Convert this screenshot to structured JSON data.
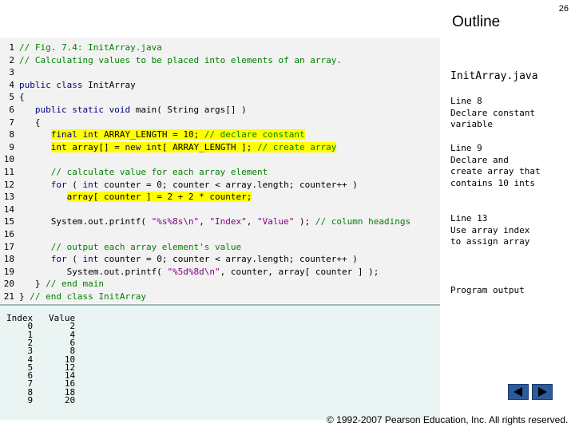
{
  "header": {
    "title": "Outline",
    "page_number": "26"
  },
  "code": {
    "lines": [
      {
        "n": "1",
        "parts": [
          {
            "t": "// Fig. 7.4: InitArray.java",
            "c": "cm"
          }
        ]
      },
      {
        "n": "2",
        "parts": [
          {
            "t": "// Calculating values to be placed into elements of an array.",
            "c": "cm"
          }
        ]
      },
      {
        "n": "3",
        "parts": []
      },
      {
        "n": "4",
        "parts": [
          {
            "t": "public class",
            "c": "kw"
          },
          {
            "t": " InitArray",
            "c": ""
          }
        ]
      },
      {
        "n": "5",
        "parts": [
          {
            "t": "{",
            "c": ""
          }
        ]
      },
      {
        "n": "6",
        "parts": [
          {
            "t": "   public static void",
            "c": "kw"
          },
          {
            "t": " main( String args[] )",
            "c": ""
          }
        ]
      },
      {
        "n": "7",
        "parts": [
          {
            "t": "   {",
            "c": ""
          }
        ]
      },
      {
        "n": "8",
        "parts": [
          {
            "t": "      ",
            "c": ""
          },
          {
            "t": "final int",
            "c": "kw",
            "h": true
          },
          {
            "t": " ARRAY_LENGTH = 10; ",
            "c": "",
            "h": true
          },
          {
            "t": "// declare constant",
            "c": "cm",
            "h": true
          }
        ]
      },
      {
        "n": "9",
        "parts": [
          {
            "t": "      ",
            "c": ""
          },
          {
            "t": "int",
            "c": "kw",
            "h": true
          },
          {
            "t": " array[] = ",
            "c": "",
            "h": true
          },
          {
            "t": "new int",
            "c": "kw",
            "h": true
          },
          {
            "t": "[ ARRAY_LENGTH ]; ",
            "c": "",
            "h": true
          },
          {
            "t": "// create array",
            "c": "cm",
            "h": true
          }
        ]
      },
      {
        "n": "10",
        "parts": []
      },
      {
        "n": "11",
        "parts": [
          {
            "t": "      // calculate value for each array element",
            "c": "cm"
          }
        ]
      },
      {
        "n": "12",
        "parts": [
          {
            "t": "      ",
            "c": ""
          },
          {
            "t": "for",
            "c": "kw"
          },
          {
            "t": " ( ",
            "c": ""
          },
          {
            "t": "int",
            "c": "kw"
          },
          {
            "t": " counter = 0; counter < array.length; counter++ )",
            "c": ""
          }
        ]
      },
      {
        "n": "13",
        "parts": [
          {
            "t": "         ",
            "c": ""
          },
          {
            "t": "array[ counter ] = 2 + 2 * counter;",
            "c": "",
            "h": true
          }
        ]
      },
      {
        "n": "14",
        "parts": []
      },
      {
        "n": "15",
        "parts": [
          {
            "t": "      System.out.printf( ",
            "c": ""
          },
          {
            "t": "\"%s%8s\\n\"",
            "c": "st"
          },
          {
            "t": ", ",
            "c": ""
          },
          {
            "t": "\"Index\"",
            "c": "st"
          },
          {
            "t": ", ",
            "c": ""
          },
          {
            "t": "\"Value\"",
            "c": "st"
          },
          {
            "t": " ); ",
            "c": ""
          },
          {
            "t": "// column headings",
            "c": "cm"
          }
        ]
      },
      {
        "n": "16",
        "parts": []
      },
      {
        "n": "17",
        "parts": [
          {
            "t": "      // output each array element's value",
            "c": "cm"
          }
        ]
      },
      {
        "n": "18",
        "parts": [
          {
            "t": "      ",
            "c": ""
          },
          {
            "t": "for",
            "c": "kw"
          },
          {
            "t": " ( ",
            "c": ""
          },
          {
            "t": "int",
            "c": "kw"
          },
          {
            "t": " counter = 0; counter < array.length; counter++ )",
            "c": ""
          }
        ]
      },
      {
        "n": "19",
        "parts": [
          {
            "t": "         System.out.printf( ",
            "c": ""
          },
          {
            "t": "\"%5d%8d\\n\"",
            "c": "st"
          },
          {
            "t": ", counter, array[ counter ] );",
            "c": ""
          }
        ]
      },
      {
        "n": "20",
        "parts": [
          {
            "t": "   } ",
            "c": ""
          },
          {
            "t": "// end main",
            "c": "cm"
          }
        ]
      },
      {
        "n": "21",
        "parts": [
          {
            "t": "} ",
            "c": ""
          },
          {
            "t": "// end class InitArray",
            "c": "cm"
          }
        ]
      }
    ]
  },
  "output": {
    "lines": [
      "Index   Value",
      "    0       2",
      "    1       4",
      "    2       6",
      "    3       8",
      "    4      10",
      "    5      12",
      "    6      14",
      "    7      16",
      "    8      18",
      "    9      20"
    ]
  },
  "side_notes": {
    "file_title": "InitArray.java",
    "line8": [
      "Line 8",
      "Declare constant",
      "variable"
    ],
    "line9": [
      "Line 9",
      "Declare and",
      "create array that",
      "contains 10 ints"
    ],
    "line13": [
      "Line 13",
      "Use array index",
      "to assign array"
    ],
    "program_output": "Program output"
  },
  "footer": {
    "copyright": "© 1992-2007 Pearson Education, Inc.  All rights reserved."
  },
  "colors": {
    "keyword": "#000080",
    "comment": "#008000",
    "string": "#800080",
    "highlight": "#ffff00",
    "nav": "#2b5b9a"
  }
}
